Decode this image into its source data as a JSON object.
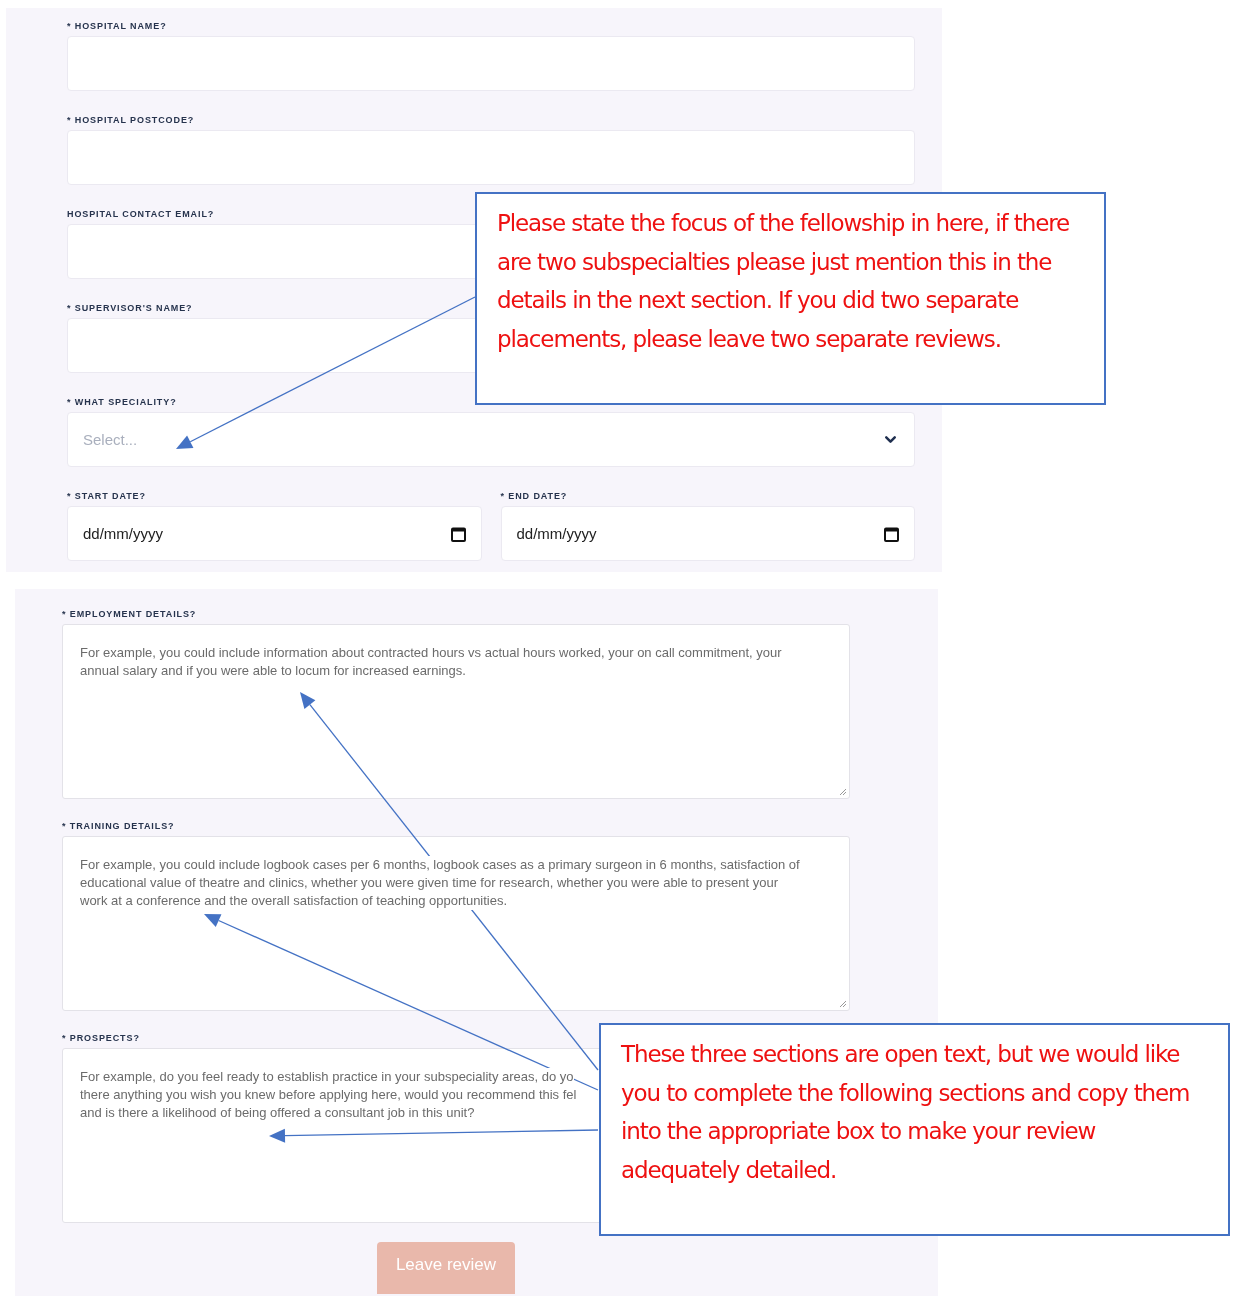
{
  "form_panel": {
    "fields": [
      {
        "label": "* HOSPITAL NAME?",
        "kind": "text"
      },
      {
        "label": "* HOSPITAL POSTCODE?",
        "kind": "text"
      },
      {
        "label": "HOSPITAL CONTACT EMAIL?",
        "kind": "text"
      },
      {
        "label": "* SUPERVISOR'S NAME?",
        "kind": "text"
      },
      {
        "label": "* WHAT SPECIALITY?",
        "kind": "select",
        "placeholder": "Select..."
      }
    ],
    "date_fields": [
      {
        "label": "* START DATE?",
        "value": "dd/mm/yyyy"
      },
      {
        "label": "* END DATE?",
        "value": "dd/mm/yyyy"
      }
    ]
  },
  "details_panel": {
    "text_areas": [
      {
        "label": "* EMPLOYMENT DETAILS?",
        "placeholder_lines": [
          "For example, you could include information about contracted hours vs actual hours worked, your on call commitment, your",
          "annual salary and if you were able to locum for increased earnings."
        ],
        "resize_grip": true
      },
      {
        "label": "* TRAINING DETAILS?",
        "placeholder_lines": [
          "For example, you could include logbook cases per 6 months, logbook cases as a primary surgeon in 6 months, satisfaction  of",
          "educational value of theatre and clinics, whether you were given time for research, whether you were able to present your",
          "work at a conference and the overall satisfaction of teaching opportunities."
        ],
        "resize_grip": true
      },
      {
        "label": "* PROSPECTS?",
        "placeholder_lines": [
          "For example, do you feel ready to establish practice in  your subspeciality areas, do yo",
          "there anything you wish you knew before applying here, would you recommend this fel",
          "and is there a likelihood of being offered a consultant job in this unit?"
        ],
        "resize_grip": false
      }
    ],
    "submit_button": {
      "label": "Leave review",
      "disabled": true
    }
  },
  "annotations": [
    {
      "text": "Please state the focus of the fellowship in here, if there are two subspecialties please just mention this in the details in the next section.  If you did two separate placements, please leave two separate reviews."
    },
    {
      "text": "These three sections are open text, but we would like you to complete the following sections and copy them into the appropriate box to make your review adequately detailed."
    }
  ]
}
